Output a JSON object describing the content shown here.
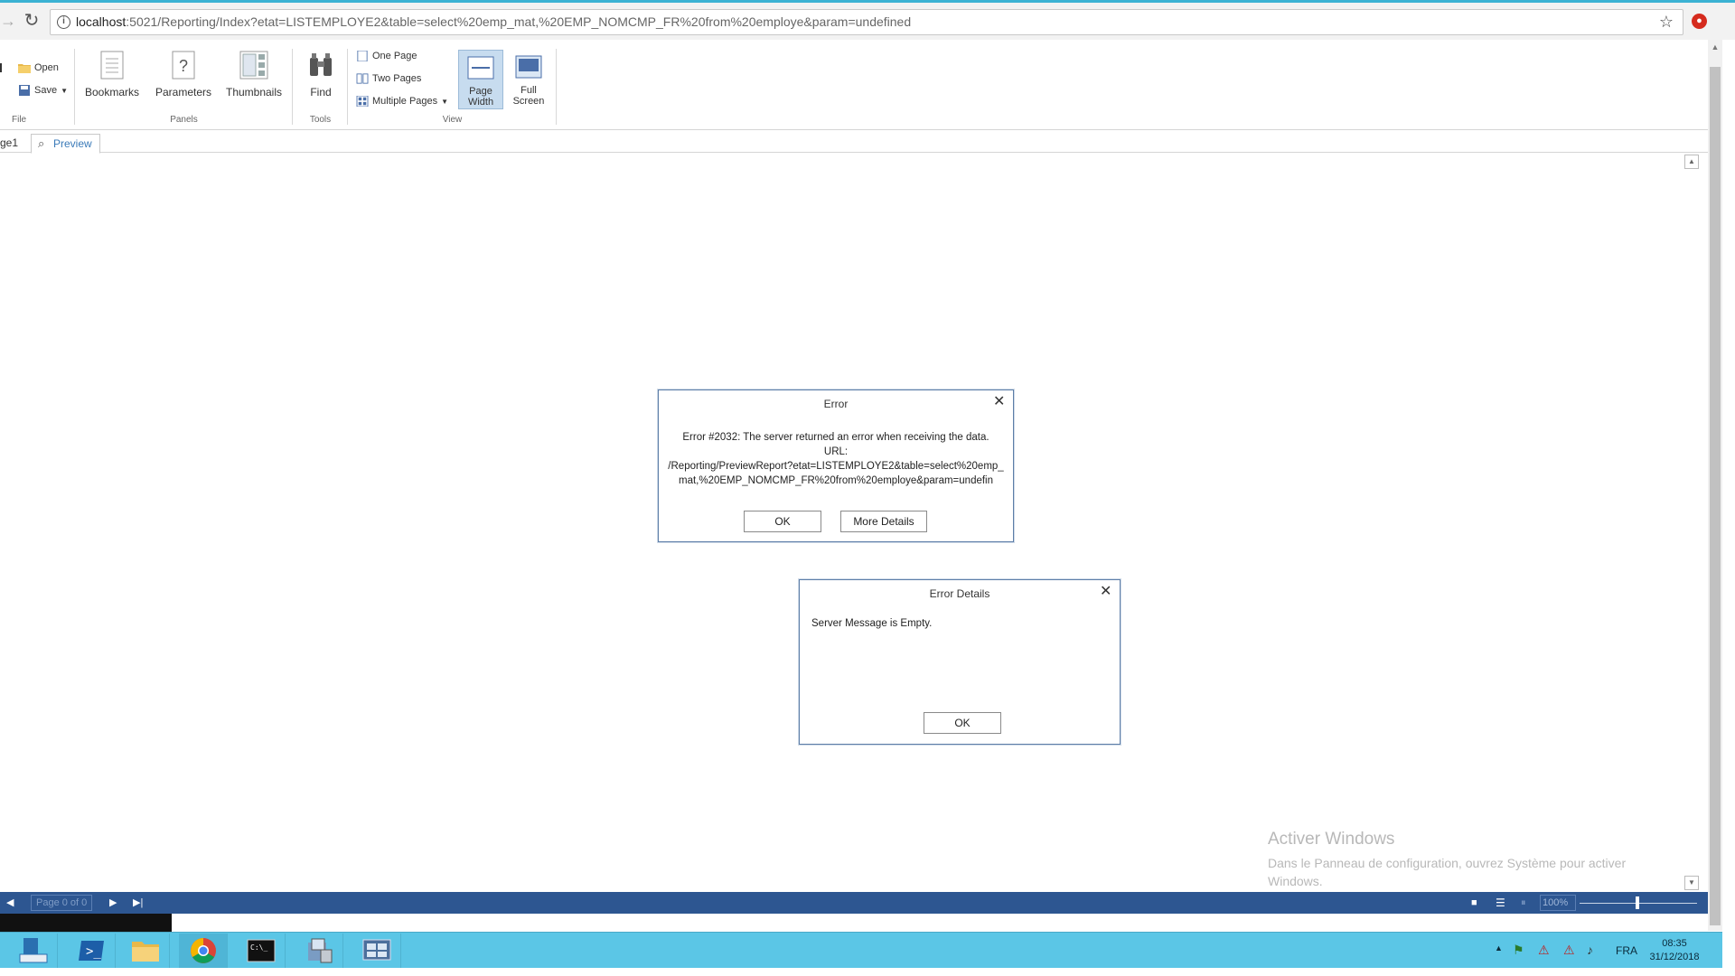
{
  "browser": {
    "url_host": "localhost",
    "url_rest": ":5021/Reporting/Index?etat=LISTEMPLOYE2&table=select%20emp_mat,%20EMP_NOMCMP_FR%20from%20employe&param=undefined"
  },
  "ribbon": {
    "file": {
      "open": "Open",
      "save": "Save",
      "label": "File"
    },
    "panels": {
      "bookmarks": "Bookmarks",
      "parameters": "Parameters",
      "thumbnails": "Thumbnails",
      "label": "Panels"
    },
    "tools": {
      "find": "Find",
      "label": "Tools"
    },
    "view": {
      "one_page": "One Page",
      "two_pages": "Two Pages",
      "multiple_pages": "Multiple Pages",
      "page_width_1": "Page",
      "page_width_2": "Width",
      "full_screen_1": "Full",
      "full_screen_2": "Screen",
      "label": "View"
    }
  },
  "tabs": {
    "page_tab": "ge1",
    "preview": "Preview"
  },
  "error_dialog": {
    "title": "Error",
    "line1": "Error #2032: The server returned an error when receiving the data.",
    "line2": "URL:",
    "line3": "/Reporting/PreviewReport?etat=LISTEMPLOYE2&table=select%20emp_mat,%20EMP_NOMCMP_FR%20from%20employe&param=undefin",
    "ok": "OK",
    "more": "More Details"
  },
  "details_dialog": {
    "title": "Error Details",
    "message": "Server Message is Empty.",
    "ok": "OK"
  },
  "watermark": {
    "title": "Activer Windows",
    "subtitle": "Dans le Panneau de configuration, ouvrez Système pour activer Windows."
  },
  "statusbar": {
    "page": "Page 0 of 0",
    "zoom": "100%",
    "zoom_level": 0.5
  },
  "taskbar": {
    "lang": "FRA",
    "time": "08:35",
    "date": "31/12/2018"
  }
}
